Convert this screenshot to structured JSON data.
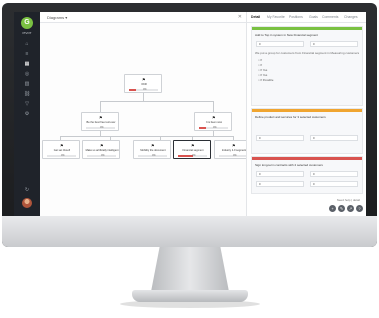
{
  "app": {
    "logo_glyph": "G",
    "logo_label": "PIVOT"
  },
  "sidebar": {
    "icons": [
      "home-icon",
      "list-icon",
      "grid-icon",
      "target-icon",
      "chart-icon",
      "link-icon",
      "filter-icon",
      "settings-icon",
      "refresh-icon"
    ],
    "icon_glyphs": [
      "⌂",
      "≡",
      "▦",
      "◎",
      "▥",
      "⛓",
      "▽",
      "⚙",
      "↻"
    ]
  },
  "main": {
    "view_label": "Diagrams ▾",
    "close_glyph": "✕",
    "nodes": [
      {
        "label": "OKR",
        "pct": "0%",
        "progress": 0.25
      },
      {
        "label": "Be the best free tool ever",
        "pct": "0%",
        "progress": 0.0
      },
      {
        "label": "It is been now",
        "pct": "0%",
        "progress": 0.25
      },
      {
        "label": "Get set Cloud!",
        "pct": "0%",
        "progress": 0.0
      },
      {
        "label": "Make us artificially intelligent",
        "pct": "0%",
        "progress": 0.0
      },
      {
        "label": "Mobility the document",
        "pct": "0%",
        "progress": 0.0
      },
      {
        "label": "Financial segment",
        "pct": "0%",
        "progress": 0.5
      },
      {
        "label": "Industry 4.0 segment",
        "pct": "0%",
        "progress": 0.0
      }
    ]
  },
  "panel": {
    "tabs": [
      "Detail",
      "My Favorite",
      "Positions",
      "Goals",
      "Comments",
      "Changes"
    ],
    "sections": [
      {
        "title": "Add to Top in system in New Financial segment",
        "fields": [
          "0",
          "0"
        ],
        "subtitle": "We put a group for customers from Financial segment in Measuring customers",
        "radios": [
          "If",
          "If",
          "If Yes",
          "If Yes",
          "If Possible"
        ]
      },
      {
        "title": "Define product and services for 3 selected customers",
        "fields": [
          "0",
          "0"
        ]
      },
      {
        "title": "Sign long-term contracts with 2 selected customers",
        "fields": [
          "0",
          "0",
          "0",
          "0"
        ]
      }
    ],
    "help_link": "Need help | detail",
    "colors": {
      "accent_green": "#7ac142",
      "warn_orange": "#f0a530",
      "danger_red": "#d9534f"
    }
  }
}
